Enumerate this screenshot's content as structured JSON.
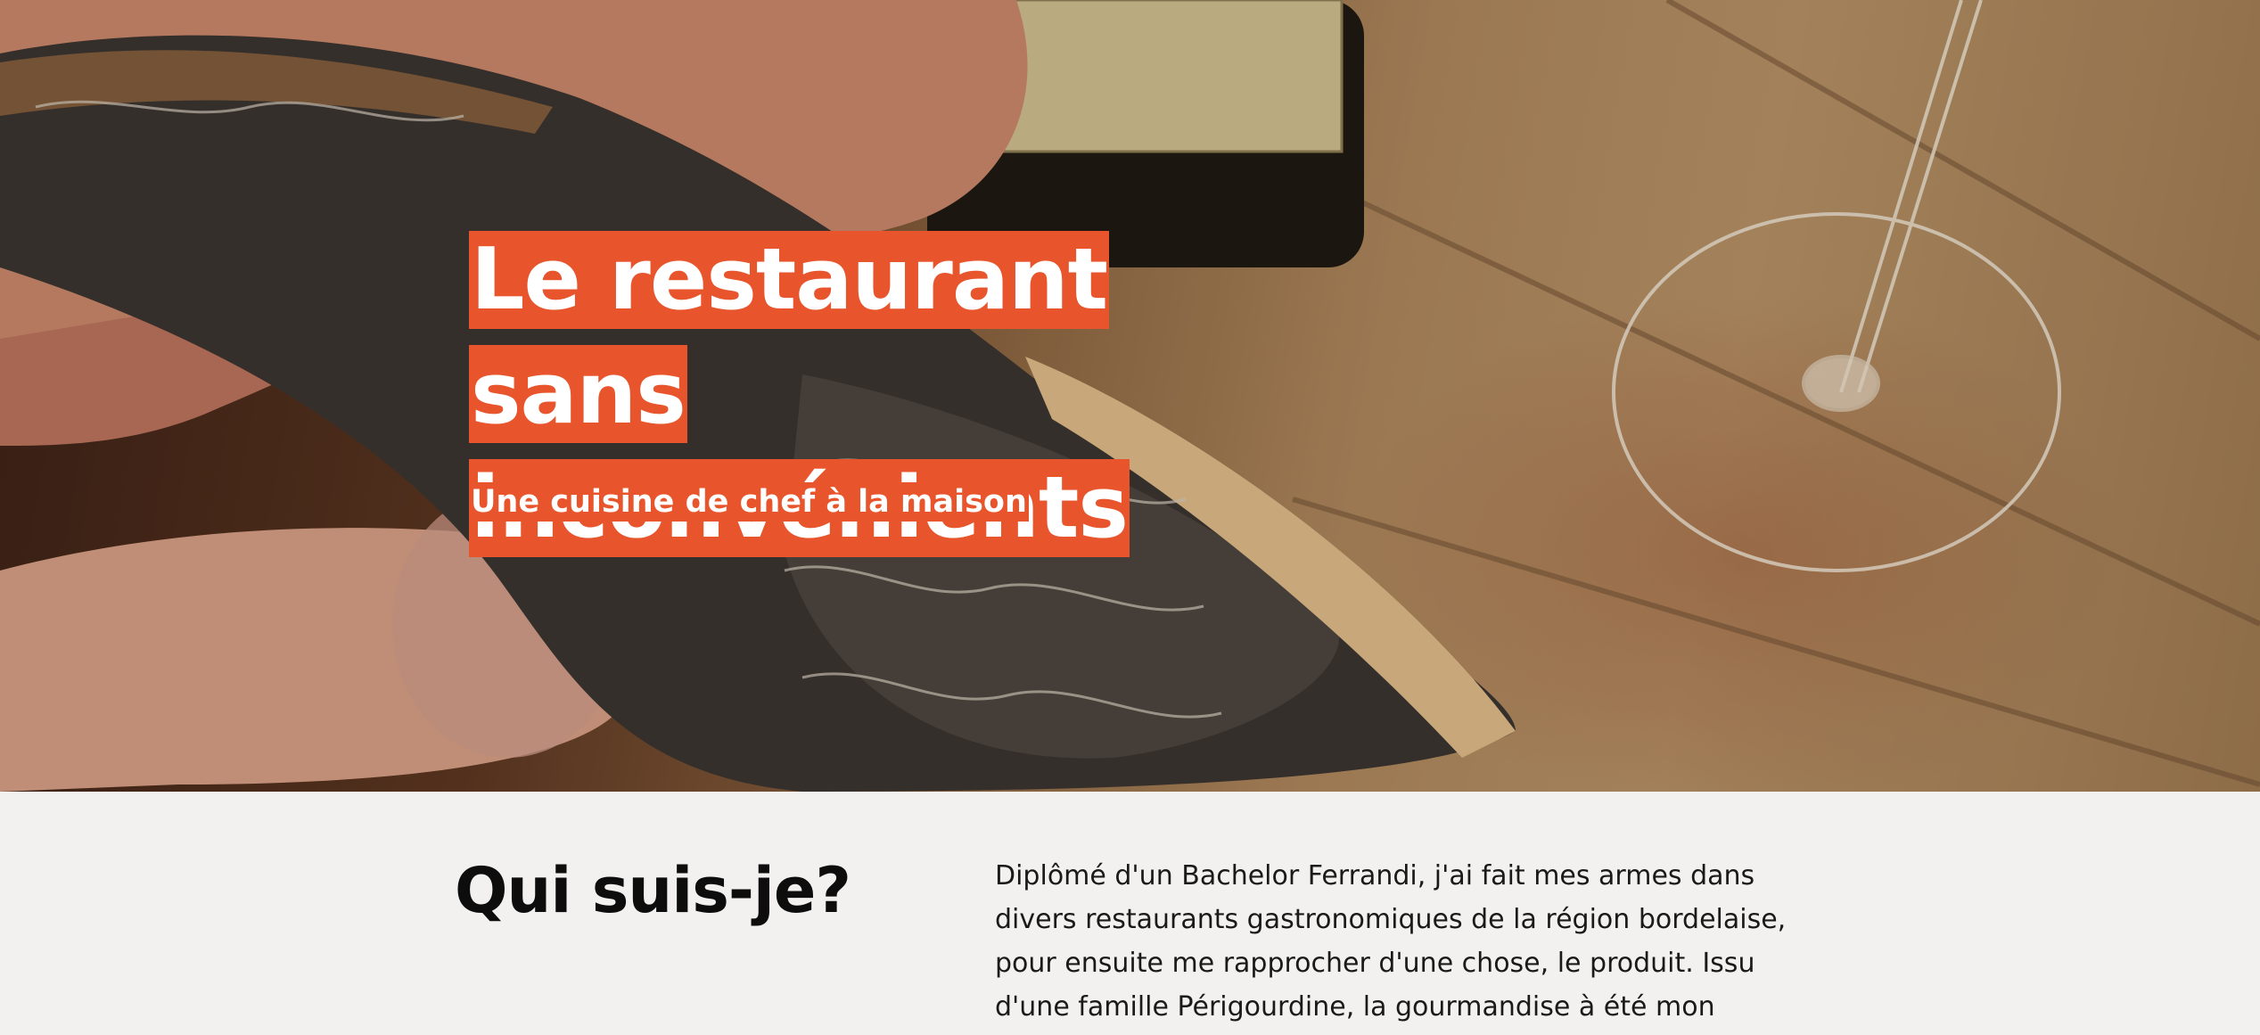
{
  "hero": {
    "title_line1": "Le restaurant sans",
    "title_line2": "inconvénients",
    "subtitle": "Une cuisine de chef à la maison",
    "accent_color": "#e8552c",
    "photo_description_icon": "truffle-toast-photo"
  },
  "about": {
    "heading": "Qui suis-je?",
    "paragraph": "Diplômé d'un Bachelor Ferrandi, j'ai fait mes armes dans divers restaurants gastronomiques de la région bordelaise, pour ensuite me rapprocher d'une chose, le produit. Issu d'une famille Périgourdine, la gourmandise à été mon"
  }
}
